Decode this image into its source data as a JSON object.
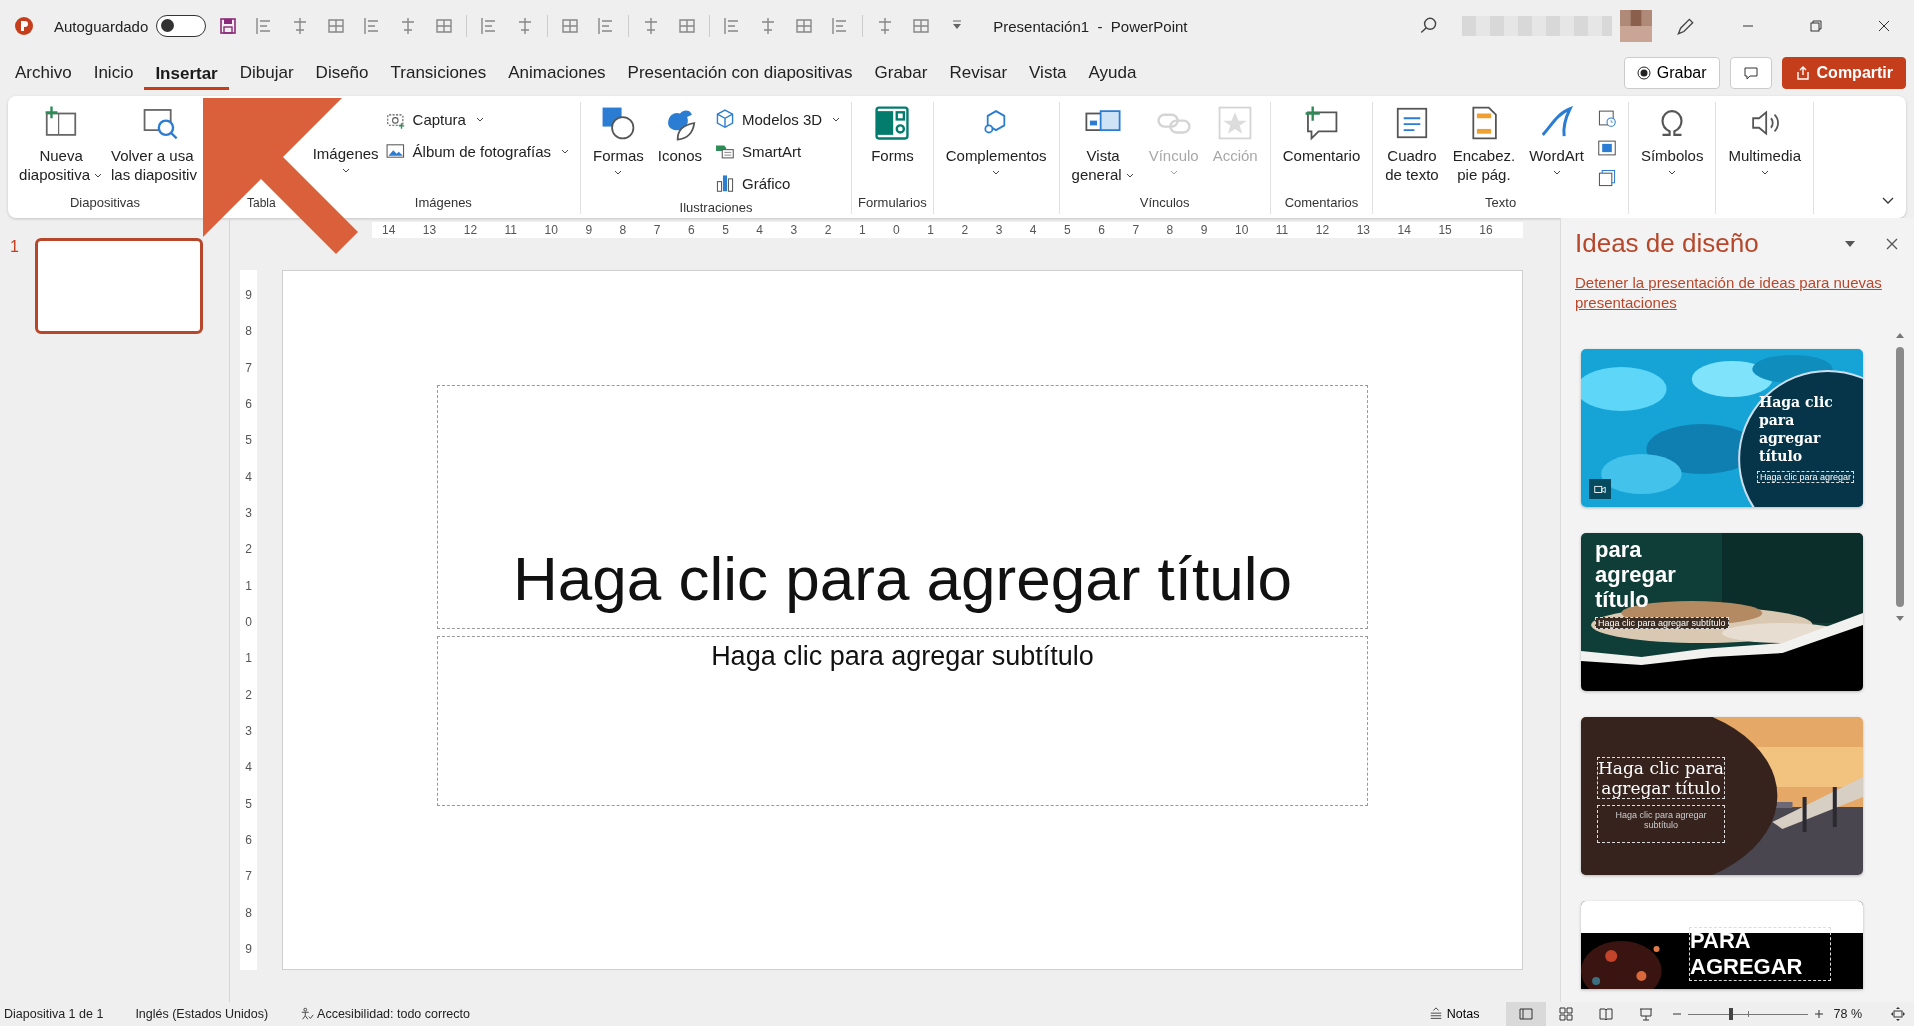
{
  "title_bar": {
    "autosave": {
      "label": "Autoguardado",
      "on": false
    },
    "title": "Presentación1  -  PowerPoint"
  },
  "tabs": [
    {
      "label": "Archivo",
      "selected": false
    },
    {
      "label": "Inicio",
      "selected": false
    },
    {
      "label": "Insertar",
      "selected": true
    },
    {
      "label": "Dibujar",
      "selected": false
    },
    {
      "label": "Diseño",
      "selected": false
    },
    {
      "label": "Transiciones",
      "selected": false
    },
    {
      "label": "Animaciones",
      "selected": false
    },
    {
      "label": "Presentación con diapositivas",
      "selected": false
    },
    {
      "label": "Grabar",
      "selected": false
    },
    {
      "label": "Revisar",
      "selected": false
    },
    {
      "label": "Vista",
      "selected": false
    },
    {
      "label": "Ayuda",
      "selected": false
    }
  ],
  "tab_actions": {
    "record": "Grabar",
    "share": "Compartir"
  },
  "ribbon": {
    "groups": [
      {
        "label": "Diapositivas",
        "buttons": [
          {
            "kind": "large",
            "lines": [
              "Nueva",
              "diapositiva"
            ],
            "dropdown": true,
            "disabled": false
          },
          {
            "kind": "large",
            "lines": [
              "Volver a usa",
              "las diapositiv"
            ],
            "dropdown": false,
            "disabled": false
          }
        ]
      },
      {
        "label": "Tabla"
      },
      {
        "label": "Imágenes",
        "buttons": [
          {
            "kind": "large",
            "lines": [
              "Imágenes"
            ],
            "dropdown": true,
            "disabled": false
          },
          {
            "kind": "small",
            "lines": [
              "Captura"
            ],
            "dropdown": true,
            "disabled": false
          },
          {
            "kind": "small",
            "lines": [
              "Álbum de fotografías"
            ],
            "dropdown": true,
            "disabled": false
          }
        ]
      },
      {
        "label": "Ilustraciones",
        "buttons": [
          {
            "kind": "large",
            "lines": [
              "Formas"
            ],
            "dropdown": true,
            "disabled": false
          },
          {
            "kind": "large",
            "lines": [
              "Iconos"
            ],
            "dropdown": false,
            "disabled": false
          },
          {
            "kind": "small",
            "lines": [
              "Modelos 3D"
            ],
            "dropdown": true,
            "disabled": false
          },
          {
            "kind": "small",
            "lines": [
              "SmartArt"
            ],
            "dropdown": false,
            "disabled": false
          },
          {
            "kind": "small",
            "lines": [
              "Gráfico"
            ],
            "dropdown": false,
            "disabled": false
          }
        ]
      },
      {
        "label": "Formularios",
        "buttons": [
          {
            "kind": "large",
            "lines": [
              "Forms"
            ],
            "dropdown": false,
            "disabled": false
          }
        ]
      },
      {
        "buttons": [
          {
            "kind": "large",
            "lines": [
              "Complementos"
            ],
            "dropdown": true,
            "disabled": false
          }
        ]
      },
      {
        "label": "Vínculos",
        "buttons": [
          {
            "kind": "large",
            "lines": [
              "Vista",
              "general"
            ],
            "dropdown": true,
            "disabled": false
          },
          {
            "kind": "large",
            "lines": [
              "Vínculo"
            ],
            "dropdown": true,
            "disabled": true
          },
          {
            "kind": "large",
            "lines": [
              "Acción"
            ],
            "dropdown": false,
            "disabled": true
          }
        ]
      },
      {
        "label": "Comentarios",
        "buttons": [
          {
            "kind": "large",
            "lines": [
              "Comentario"
            ],
            "dropdown": false,
            "disabled": false
          }
        ]
      },
      {
        "label": "Texto",
        "buttons": [
          {
            "kind": "large",
            "lines": [
              "Cuadro",
              "de texto"
            ],
            "dropdown": false,
            "disabled": false
          },
          {
            "kind": "large",
            "lines": [
              "Encabez.",
              "pie pág."
            ],
            "dropdown": false,
            "disabled": false
          },
          {
            "kind": "large",
            "lines": [
              "WordArt"
            ],
            "dropdown": true,
            "disabled": false
          },
          {
            "kind": "icon",
            "dropdown": false,
            "disabled": false
          },
          {
            "kind": "icon",
            "dropdown": false,
            "disabled": false
          },
          {
            "kind": "icon",
            "dropdown": false,
            "disabled": false
          }
        ]
      },
      {
        "buttons": [
          {
            "kind": "large",
            "lines": [
              "Símbolos"
            ],
            "dropdown": true,
            "disabled": false
          }
        ]
      },
      {
        "buttons": [
          {
            "kind": "large",
            "lines": [
              "Multimedia"
            ],
            "dropdown": true,
            "disabled": false
          }
        ]
      }
    ]
  },
  "slides_panel": {
    "slides": [
      {
        "number": "1",
        "selected": true
      }
    ]
  },
  "rulers": {
    "horizontal": [
      "14",
      "13",
      "12",
      "11",
      "10",
      "9",
      "8",
      "7",
      "6",
      "5",
      "4",
      "3",
      "2",
      "1",
      "0",
      "1",
      "2",
      "3",
      "4",
      "5",
      "6",
      "7",
      "8",
      "9",
      "10",
      "11",
      "12",
      "13",
      "14",
      "15",
      "16"
    ],
    "vertical": [
      "9",
      "8",
      "7",
      "6",
      "5",
      "4",
      "3",
      "2",
      "1",
      "0",
      "1",
      "2",
      "3",
      "4",
      "5",
      "6",
      "7",
      "8",
      "9"
    ]
  },
  "slide": {
    "title_placeholder": "Haga clic para agregar título",
    "subtitle_placeholder": "Haga clic para agregar subtítulo"
  },
  "design_ideas": {
    "title": "Ideas de diseño",
    "link": "Detener la presentación de ideas para nuevas presentaciones",
    "thumbnails": [
      {
        "kind": "water",
        "title": "Haga clic para agregar título",
        "subtitle": "Haga clic para agregar"
      },
      {
        "kind": "books",
        "title": "para agregar título",
        "subtitle": "Haga clic para agregar subtítulo"
      },
      {
        "kind": "sunset",
        "title": "Haga clic para agregar título",
        "subtitle": "Haga clic para agregar subtítulo"
      },
      {
        "kind": "space",
        "title": "PARA AGREGAR"
      }
    ]
  },
  "status_bar": {
    "slide_info": "Diapositiva 1 de 1",
    "language": "Inglés (Estados Unidos)",
    "accessibility": "Accesibilidad: todo correcto",
    "notes": "Notas",
    "views": [
      {
        "selected": true
      },
      {
        "selected": false
      },
      {
        "selected": false
      },
      {
        "selected": false
      }
    ],
    "zoom": {
      "level": 0.36,
      "reading": "78 %"
    }
  }
}
